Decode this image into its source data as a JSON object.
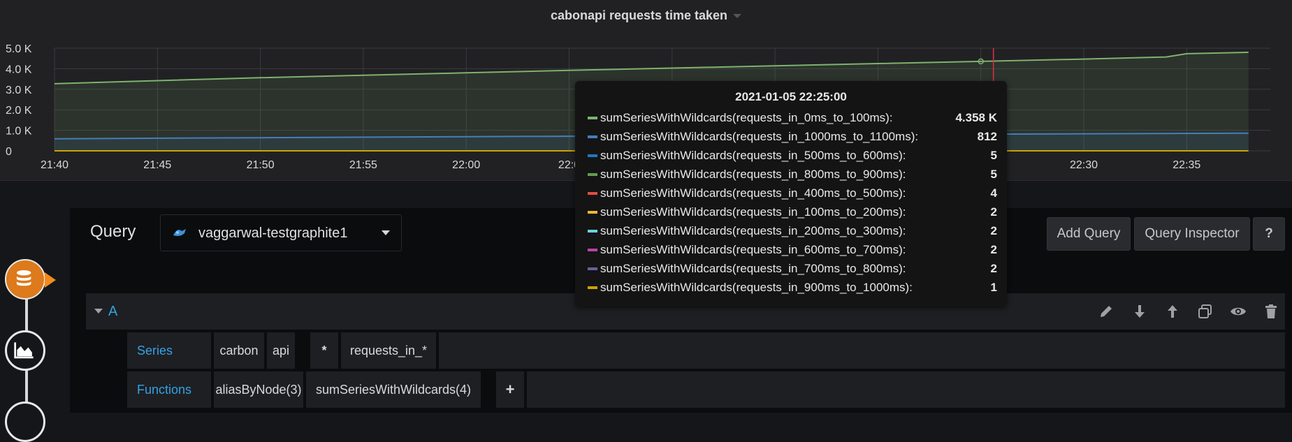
{
  "panel": {
    "title": "cabonapi requests time taken"
  },
  "chart_data": {
    "type": "line",
    "title": "cabonapi requests time taken",
    "x_ticks": [
      "21:40",
      "21:45",
      "21:50",
      "21:55",
      "22:00",
      "22:0",
      "22:30",
      "22:35"
    ],
    "y_ticks": [
      "5.0 K",
      "4.0 K",
      "3.0 K",
      "2.0 K",
      "1.0 K",
      "0"
    ],
    "ylim": [
      0,
      5000
    ],
    "grid": true,
    "series": [
      {
        "name": "sumSeriesWithWildcards(requests_in_0ms_to_100ms)",
        "color": "#7eb26d",
        "x": [
          "21:40",
          "21:45",
          "21:50",
          "21:55",
          "22:00",
          "22:05",
          "22:10",
          "22:15",
          "22:20",
          "22:25",
          "22:30",
          "22:34",
          "22:35",
          "22:38"
        ],
        "values": [
          3270,
          3420,
          3560,
          3680,
          3800,
          3920,
          4030,
          4140,
          4250,
          4358,
          4470,
          4570,
          4730,
          4800
        ]
      },
      {
        "name": "sumSeriesWithWildcards(requests_in_1000ms_to_1100ms)",
        "color": "#447ebc",
        "x": [
          "21:40",
          "21:50",
          "22:00",
          "22:10",
          "22:20",
          "22:25",
          "22:30",
          "22:38"
        ],
        "values": [
          590,
          640,
          690,
          730,
          780,
          812,
          830,
          860
        ]
      },
      {
        "name": "sumSeriesWithWildcards(requests_in_900ms_to_1000ms)",
        "color": "#cca300",
        "x": [
          "21:40",
          "22:38"
        ],
        "values": [
          1,
          1
        ]
      }
    ],
    "hover_time": "22:25"
  },
  "tooltip": {
    "time": "2021-01-05 22:25:00",
    "rows": [
      {
        "name": "sumSeriesWithWildcards(requests_in_0ms_to_100ms):",
        "value": "4.358 K",
        "color": "#7eb26d"
      },
      {
        "name": "sumSeriesWithWildcards(requests_in_1000ms_to_1100ms):",
        "value": "812",
        "color": "#447ebc"
      },
      {
        "name": "sumSeriesWithWildcards(requests_in_500ms_to_600ms):",
        "value": "5",
        "color": "#1f78c1"
      },
      {
        "name": "sumSeriesWithWildcards(requests_in_800ms_to_900ms):",
        "value": "5",
        "color": "#629e51"
      },
      {
        "name": "sumSeriesWithWildcards(requests_in_400ms_to_500ms):",
        "value": "4",
        "color": "#e24d42"
      },
      {
        "name": "sumSeriesWithWildcards(requests_in_100ms_to_200ms):",
        "value": "2",
        "color": "#eab839"
      },
      {
        "name": "sumSeriesWithWildcards(requests_in_200ms_to_300ms):",
        "value": "2",
        "color": "#6ed0e0"
      },
      {
        "name": "sumSeriesWithWildcards(requests_in_600ms_to_700ms):",
        "value": "2",
        "color": "#ba43a9"
      },
      {
        "name": "sumSeriesWithWildcards(requests_in_700ms_to_800ms):",
        "value": "2",
        "color": "#705da0"
      },
      {
        "name": "sumSeriesWithWildcards(requests_in_900ms_to_1000ms):",
        "value": "1",
        "color": "#cca300"
      }
    ]
  },
  "query": {
    "label": "Query",
    "datasource": "vaggarwal-testgraphite1",
    "add_query": "Add Query",
    "query_inspector": "Query Inspector",
    "help": "?"
  },
  "row_a": {
    "label": "A",
    "icons": [
      "pencil-icon",
      "arrow-down-icon",
      "arrow-up-icon",
      "duplicate-icon",
      "eye-icon",
      "trash-icon"
    ],
    "series_label": "Series",
    "series_segments": [
      "carbon",
      "api",
      "*",
      "requests_in_*"
    ],
    "functions_label": "Functions",
    "functions": [
      "aliasByNode(3)",
      "sumSeriesWithWildcards(4)"
    ],
    "add_function": "+"
  },
  "colors": {
    "accent": "#33a2e5",
    "step_active": "#dc7a1c"
  }
}
